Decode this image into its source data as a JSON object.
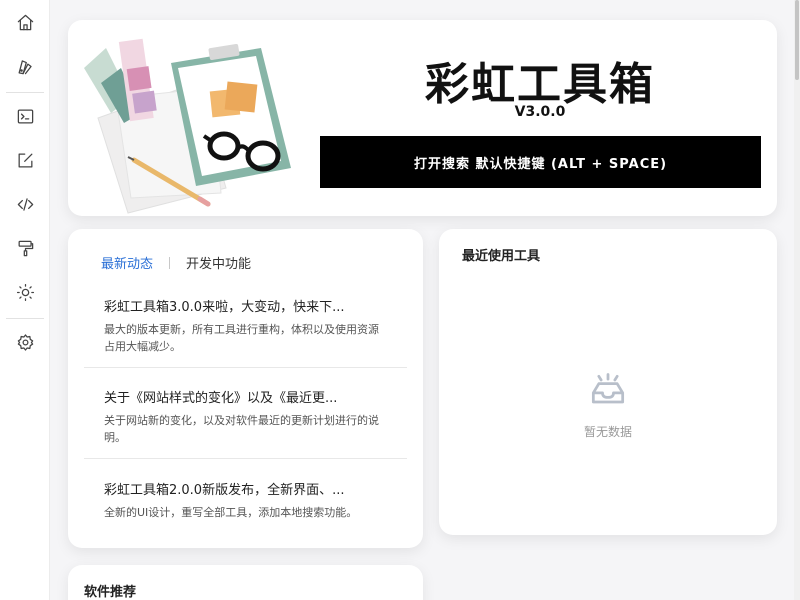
{
  "sidebar": {
    "items": [
      {
        "icon": "home-icon"
      },
      {
        "icon": "color-palette-icon"
      },
      {
        "icon": "terminal-icon"
      },
      {
        "icon": "edit-icon"
      },
      {
        "icon": "code-icon"
      },
      {
        "icon": "paint-roller-icon"
      },
      {
        "icon": "sun-icon"
      },
      {
        "icon": "settings-icon"
      }
    ]
  },
  "hero": {
    "title": "彩虹工具箱",
    "version": "V3.0.0",
    "search_label": "打开搜索 默认快捷键 (ALT + SPACE)"
  },
  "news": {
    "tabs": [
      "最新动态",
      "开发中功能"
    ],
    "items": [
      {
        "title": "彩虹工具箱3.0.0来啦，大变动，快来下...",
        "desc": "最大的版本更新，所有工具进行重构，体积以及使用资源占用大幅减少。"
      },
      {
        "title": "关于《网站样式的变化》以及《最近更...",
        "desc": "关于网站新的变化，以及对软件最近的更新计划进行的说明。"
      },
      {
        "title": "彩虹工具箱2.0.0新版发布，全新界面、...",
        "desc": "全新的UI设计，重写全部工具，添加本地搜索功能。"
      }
    ]
  },
  "recent": {
    "title": "最近使用工具",
    "empty_text": "暂无数据",
    "empty_icon": "empty-inbox-icon"
  },
  "software": {
    "title": "软件推荐"
  },
  "colors": {
    "accent": "#2a6fd6",
    "button_bg": "#000000",
    "page_bg": "#f5f5f7"
  }
}
